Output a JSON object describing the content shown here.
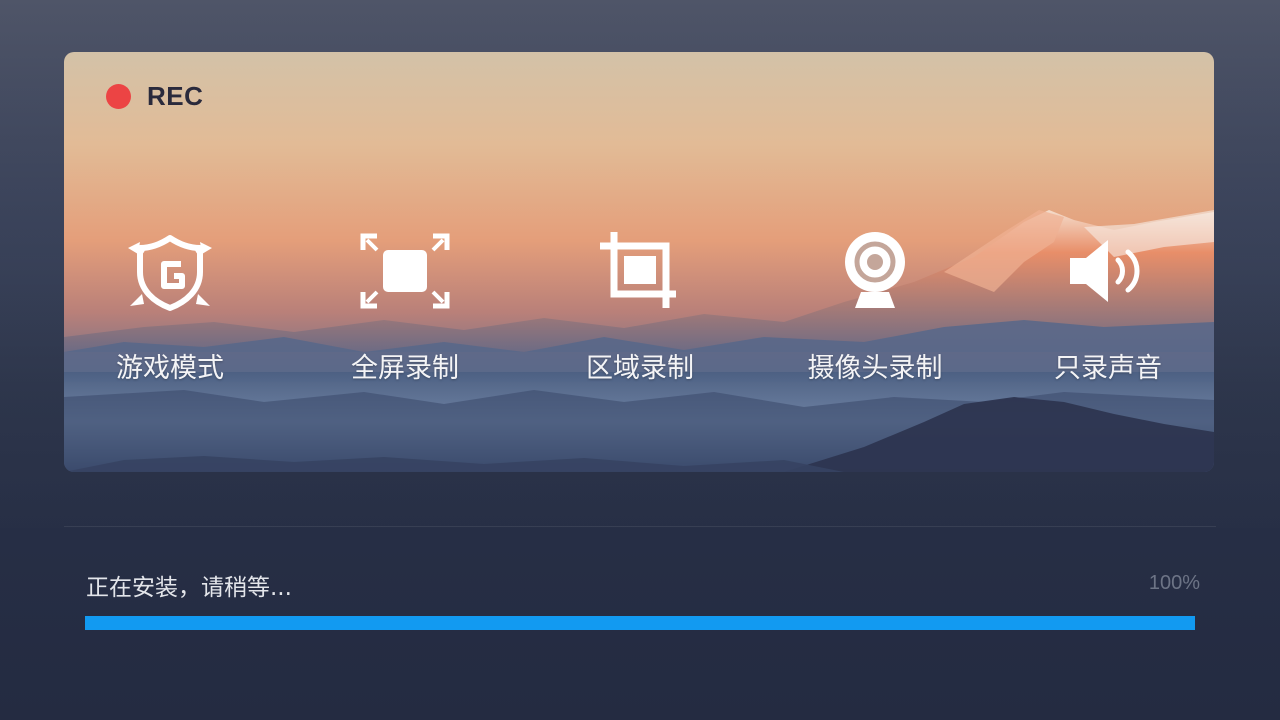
{
  "recording_indicator": {
    "label": "REC",
    "dot_color": "#ec4444"
  },
  "modes": [
    {
      "label": "游戏模式",
      "icon": "game-shield-icon"
    },
    {
      "label": "全屏录制",
      "icon": "fullscreen-icon"
    },
    {
      "label": "区域录制",
      "icon": "crop-icon"
    },
    {
      "label": "摄像头录制",
      "icon": "webcam-icon"
    },
    {
      "label": "只录声音",
      "icon": "speaker-icon"
    }
  ],
  "install": {
    "status_text": "正在安装，请稍等...",
    "percent_text": "100%",
    "progress": 1.0,
    "progress_color": "#129af1"
  }
}
